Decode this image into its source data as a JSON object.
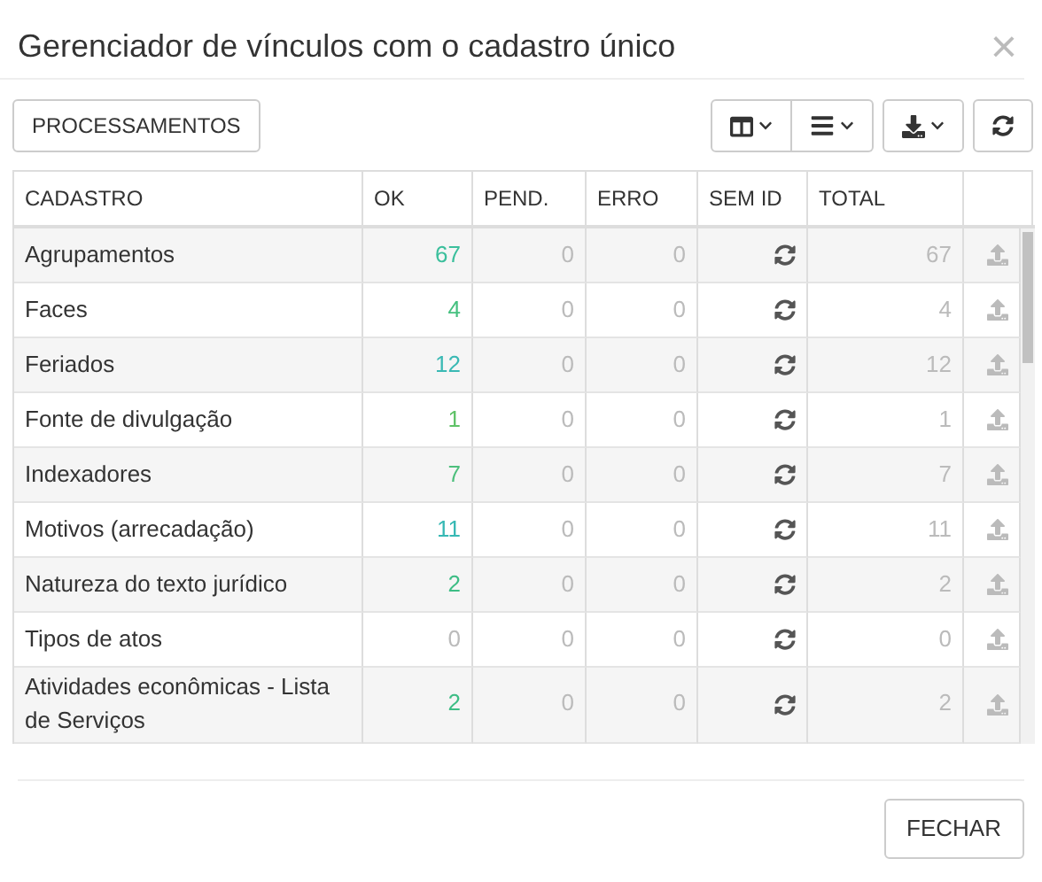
{
  "window": {
    "title": "Gerenciador de vínculos com o cadastro único",
    "close": "×"
  },
  "toolbar": {
    "processing_button": "PROCESSAMENTOS"
  },
  "table": {
    "columns": [
      "CADASTRO",
      "OK",
      "PEND.",
      "ERRO",
      "SEM ID",
      "TOTAL"
    ],
    "rows": [
      {
        "name": "Agrupamentos",
        "ok": "67",
        "color": "#3bbf9c",
        "pend": "0",
        "erro": "0",
        "total": "67"
      },
      {
        "name": "Faces",
        "ok": "4",
        "color": "#45c07f",
        "pend": "0",
        "erro": "0",
        "total": "4"
      },
      {
        "name": "Feriados",
        "ok": "12",
        "color": "#3ab9b4",
        "pend": "0",
        "erro": "0",
        "total": "12"
      },
      {
        "name": "Fonte de divulgação",
        "ok": "1",
        "color": "#5fc267",
        "pend": "0",
        "erro": "0",
        "total": "1"
      },
      {
        "name": "Indexadores",
        "ok": "7",
        "color": "#4dbf7c",
        "pend": "0",
        "erro": "0",
        "total": "7"
      },
      {
        "name": "Motivos (arrecadação)",
        "ok": "11",
        "color": "#36b8b4",
        "pend": "0",
        "erro": "0",
        "total": "11"
      },
      {
        "name": "Natureza do texto jurídico",
        "ok": "2",
        "color": "#3dbd85",
        "pend": "0",
        "erro": "0",
        "total": "2"
      },
      {
        "name": "Tipos de atos",
        "ok": "0",
        "color": "#bbbbbb",
        "pend": "0",
        "erro": "0",
        "total": "0"
      },
      {
        "name": "Atividades econômicas - Lista de Serviços",
        "ok": "2",
        "color": "#3dbd85",
        "pend": "0",
        "erro": "0",
        "total": "2"
      }
    ]
  },
  "footer": {
    "close_button": "FECHAR"
  }
}
